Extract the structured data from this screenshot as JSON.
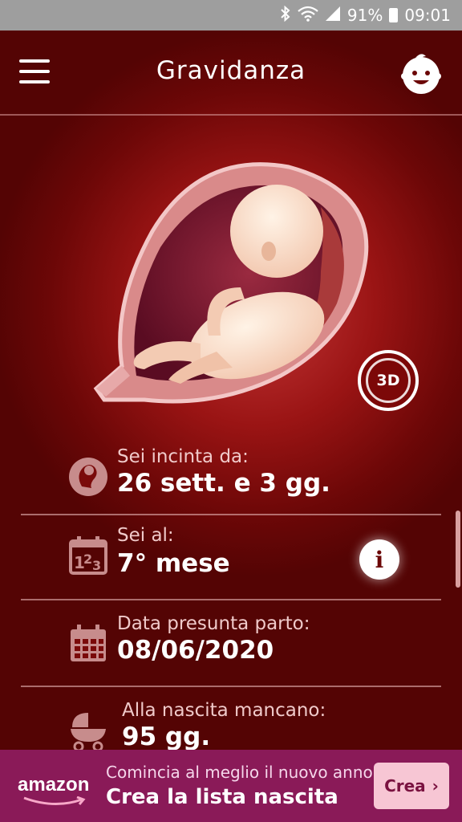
{
  "status_bar": {
    "battery": "91%",
    "time": "09:01",
    "icons": [
      "bluetooth-icon",
      "wifi-icon",
      "signal-icon",
      "battery-icon"
    ]
  },
  "header": {
    "title": "Gravidanza",
    "menu_icon": "hamburger-menu-icon",
    "profile_icon": "baby-face-icon"
  },
  "illustration": {
    "subject": "fetus-in-womb",
    "button_3d": "3D"
  },
  "rows": [
    {
      "icon": "fetus-icon",
      "label": "Sei incinta da:",
      "value": "26 sett. e 3 gg."
    },
    {
      "icon": "calendar-123-icon",
      "label": "Sei al:",
      "value": "7° mese"
    },
    {
      "icon": "calendar-icon",
      "label": "Data presunta parto:",
      "value": "08/06/2020"
    },
    {
      "icon": "stroller-icon",
      "label": "Alla nascita mancano:",
      "value": "95 gg."
    }
  ],
  "info_button": "i",
  "ad": {
    "logo": "amazon",
    "line1": "Comincia al meglio il nuovo anno.",
    "line2": "Crea la lista nascita",
    "button": "Crea",
    "button_chevron": "›"
  },
  "colors": {
    "background": "#6c0707",
    "accent_glow": "#c6393a",
    "ad_background": "#8a1a58",
    "ad_button": "#f7c6d4",
    "status_bar": "#9e9e9e"
  }
}
